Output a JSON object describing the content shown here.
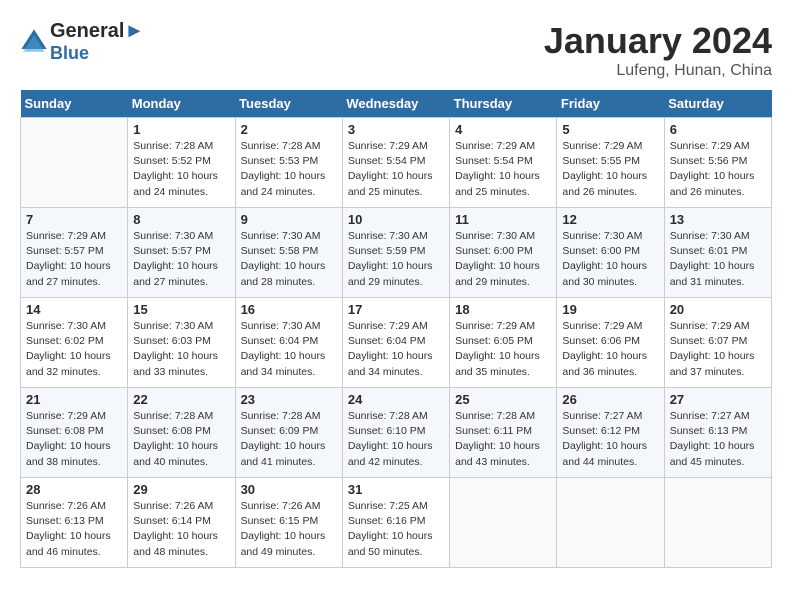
{
  "header": {
    "logo_line1": "General",
    "logo_line2": "Blue",
    "month": "January 2024",
    "location": "Lufeng, Hunan, China"
  },
  "weekdays": [
    "Sunday",
    "Monday",
    "Tuesday",
    "Wednesday",
    "Thursday",
    "Friday",
    "Saturday"
  ],
  "weeks": [
    [
      {
        "day": "",
        "sunrise": "",
        "sunset": "",
        "daylight": ""
      },
      {
        "day": "1",
        "sunrise": "Sunrise: 7:28 AM",
        "sunset": "Sunset: 5:52 PM",
        "daylight": "Daylight: 10 hours and 24 minutes."
      },
      {
        "day": "2",
        "sunrise": "Sunrise: 7:28 AM",
        "sunset": "Sunset: 5:53 PM",
        "daylight": "Daylight: 10 hours and 24 minutes."
      },
      {
        "day": "3",
        "sunrise": "Sunrise: 7:29 AM",
        "sunset": "Sunset: 5:54 PM",
        "daylight": "Daylight: 10 hours and 25 minutes."
      },
      {
        "day": "4",
        "sunrise": "Sunrise: 7:29 AM",
        "sunset": "Sunset: 5:54 PM",
        "daylight": "Daylight: 10 hours and 25 minutes."
      },
      {
        "day": "5",
        "sunrise": "Sunrise: 7:29 AM",
        "sunset": "Sunset: 5:55 PM",
        "daylight": "Daylight: 10 hours and 26 minutes."
      },
      {
        "day": "6",
        "sunrise": "Sunrise: 7:29 AM",
        "sunset": "Sunset: 5:56 PM",
        "daylight": "Daylight: 10 hours and 26 minutes."
      }
    ],
    [
      {
        "day": "7",
        "sunrise": "Sunrise: 7:29 AM",
        "sunset": "Sunset: 5:57 PM",
        "daylight": "Daylight: 10 hours and 27 minutes."
      },
      {
        "day": "8",
        "sunrise": "Sunrise: 7:30 AM",
        "sunset": "Sunset: 5:57 PM",
        "daylight": "Daylight: 10 hours and 27 minutes."
      },
      {
        "day": "9",
        "sunrise": "Sunrise: 7:30 AM",
        "sunset": "Sunset: 5:58 PM",
        "daylight": "Daylight: 10 hours and 28 minutes."
      },
      {
        "day": "10",
        "sunrise": "Sunrise: 7:30 AM",
        "sunset": "Sunset: 5:59 PM",
        "daylight": "Daylight: 10 hours and 29 minutes."
      },
      {
        "day": "11",
        "sunrise": "Sunrise: 7:30 AM",
        "sunset": "Sunset: 6:00 PM",
        "daylight": "Daylight: 10 hours and 29 minutes."
      },
      {
        "day": "12",
        "sunrise": "Sunrise: 7:30 AM",
        "sunset": "Sunset: 6:00 PM",
        "daylight": "Daylight: 10 hours and 30 minutes."
      },
      {
        "day": "13",
        "sunrise": "Sunrise: 7:30 AM",
        "sunset": "Sunset: 6:01 PM",
        "daylight": "Daylight: 10 hours and 31 minutes."
      }
    ],
    [
      {
        "day": "14",
        "sunrise": "Sunrise: 7:30 AM",
        "sunset": "Sunset: 6:02 PM",
        "daylight": "Daylight: 10 hours and 32 minutes."
      },
      {
        "day": "15",
        "sunrise": "Sunrise: 7:30 AM",
        "sunset": "Sunset: 6:03 PM",
        "daylight": "Daylight: 10 hours and 33 minutes."
      },
      {
        "day": "16",
        "sunrise": "Sunrise: 7:30 AM",
        "sunset": "Sunset: 6:04 PM",
        "daylight": "Daylight: 10 hours and 34 minutes."
      },
      {
        "day": "17",
        "sunrise": "Sunrise: 7:29 AM",
        "sunset": "Sunset: 6:04 PM",
        "daylight": "Daylight: 10 hours and 34 minutes."
      },
      {
        "day": "18",
        "sunrise": "Sunrise: 7:29 AM",
        "sunset": "Sunset: 6:05 PM",
        "daylight": "Daylight: 10 hours and 35 minutes."
      },
      {
        "day": "19",
        "sunrise": "Sunrise: 7:29 AM",
        "sunset": "Sunset: 6:06 PM",
        "daylight": "Daylight: 10 hours and 36 minutes."
      },
      {
        "day": "20",
        "sunrise": "Sunrise: 7:29 AM",
        "sunset": "Sunset: 6:07 PM",
        "daylight": "Daylight: 10 hours and 37 minutes."
      }
    ],
    [
      {
        "day": "21",
        "sunrise": "Sunrise: 7:29 AM",
        "sunset": "Sunset: 6:08 PM",
        "daylight": "Daylight: 10 hours and 38 minutes."
      },
      {
        "day": "22",
        "sunrise": "Sunrise: 7:28 AM",
        "sunset": "Sunset: 6:08 PM",
        "daylight": "Daylight: 10 hours and 40 minutes."
      },
      {
        "day": "23",
        "sunrise": "Sunrise: 7:28 AM",
        "sunset": "Sunset: 6:09 PM",
        "daylight": "Daylight: 10 hours and 41 minutes."
      },
      {
        "day": "24",
        "sunrise": "Sunrise: 7:28 AM",
        "sunset": "Sunset: 6:10 PM",
        "daylight": "Daylight: 10 hours and 42 minutes."
      },
      {
        "day": "25",
        "sunrise": "Sunrise: 7:28 AM",
        "sunset": "Sunset: 6:11 PM",
        "daylight": "Daylight: 10 hours and 43 minutes."
      },
      {
        "day": "26",
        "sunrise": "Sunrise: 7:27 AM",
        "sunset": "Sunset: 6:12 PM",
        "daylight": "Daylight: 10 hours and 44 minutes."
      },
      {
        "day": "27",
        "sunrise": "Sunrise: 7:27 AM",
        "sunset": "Sunset: 6:13 PM",
        "daylight": "Daylight: 10 hours and 45 minutes."
      }
    ],
    [
      {
        "day": "28",
        "sunrise": "Sunrise: 7:26 AM",
        "sunset": "Sunset: 6:13 PM",
        "daylight": "Daylight: 10 hours and 46 minutes."
      },
      {
        "day": "29",
        "sunrise": "Sunrise: 7:26 AM",
        "sunset": "Sunset: 6:14 PM",
        "daylight": "Daylight: 10 hours and 48 minutes."
      },
      {
        "day": "30",
        "sunrise": "Sunrise: 7:26 AM",
        "sunset": "Sunset: 6:15 PM",
        "daylight": "Daylight: 10 hours and 49 minutes."
      },
      {
        "day": "31",
        "sunrise": "Sunrise: 7:25 AM",
        "sunset": "Sunset: 6:16 PM",
        "daylight": "Daylight: 10 hours and 50 minutes."
      },
      {
        "day": "",
        "sunrise": "",
        "sunset": "",
        "daylight": ""
      },
      {
        "day": "",
        "sunrise": "",
        "sunset": "",
        "daylight": ""
      },
      {
        "day": "",
        "sunrise": "",
        "sunset": "",
        "daylight": ""
      }
    ]
  ]
}
